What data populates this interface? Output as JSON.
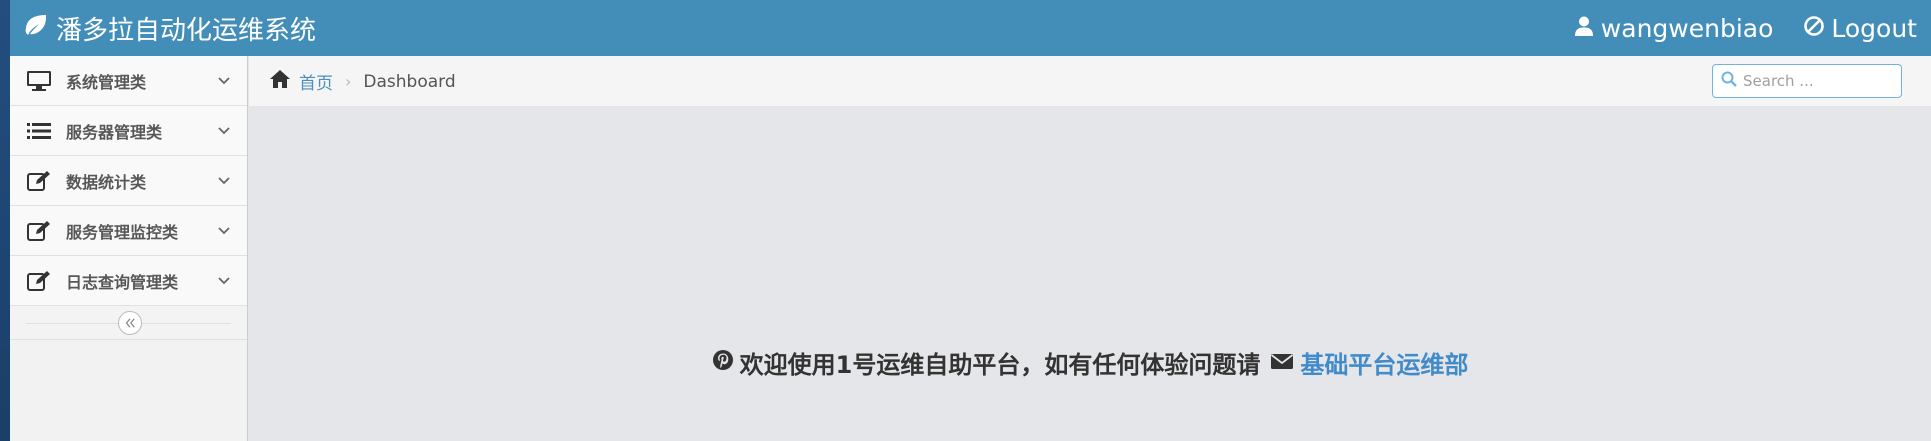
{
  "app": {
    "title": "潘多拉自动化运维系统",
    "username": "wangwenbiao",
    "logout_label": "Logout"
  },
  "sidebar": {
    "items": [
      {
        "label": "系统管理类",
        "icon": "desktop-icon"
      },
      {
        "label": "服务器管理类",
        "icon": "list-icon"
      },
      {
        "label": "数据统计类",
        "icon": "edit-icon"
      },
      {
        "label": "服务管理监控类",
        "icon": "edit-icon"
      },
      {
        "label": "日志查询管理类",
        "icon": "edit-icon"
      }
    ]
  },
  "breadcrumb": {
    "home_label": "首页",
    "current_label": "Dashboard",
    "separator": "›"
  },
  "search": {
    "placeholder": "Search ..."
  },
  "main": {
    "welcome_text": "欢迎使用1号运维自助平台，如有任何体验问题请",
    "dept_link": "基础平台运维部"
  },
  "colors": {
    "navbar": "#438eb9",
    "link": "#428bca",
    "content_bg": "#e5e6e9"
  }
}
